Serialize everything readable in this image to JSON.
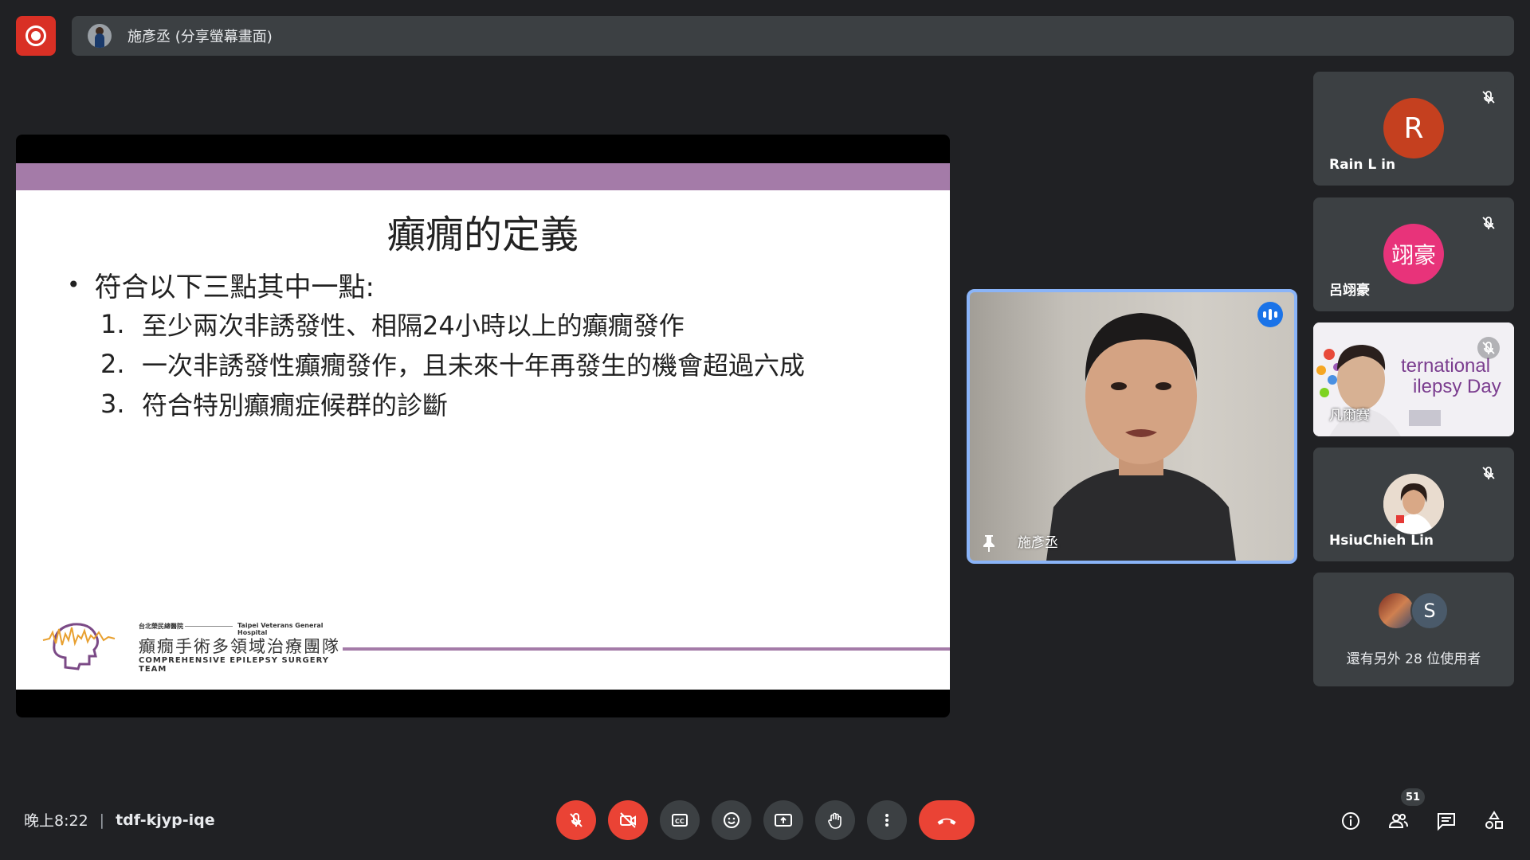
{
  "top_bar": {
    "presenter_label": "施彥丞 (分享螢幕畫面)"
  },
  "slide": {
    "title": "癲癇的定義",
    "bullet": "符合以下三點其中一點:",
    "items": [
      {
        "num": "1.",
        "text": "至少兩次非誘發性、相隔24小時以上的癲癇發作"
      },
      {
        "num": "2.",
        "text": "一次非誘發性癲癇發作，且未來十年再發生的機會超過六成"
      },
      {
        "num": "3.",
        "text": "符合特別癲癇症候群的診斷"
      }
    ],
    "logo": {
      "small_cn": "台北榮民總醫院",
      "small_en": "Taipei Veterans General Hospital",
      "main": "癲癇手術多領域治療團隊",
      "en": "COMPREHENSIVE EPILEPSY SURGERY TEAM"
    }
  },
  "speaker": {
    "name": "施彥丞"
  },
  "participants": [
    {
      "name": "Rain L in",
      "initial": "R",
      "color": "#c5401f"
    },
    {
      "name": "呂翊豪",
      "initial": "翊豪",
      "color": "#e8337a"
    },
    {
      "name": "凡爾賽",
      "banner_line1": "ternational",
      "banner_line2": "ilepsy Day"
    },
    {
      "name": "HsiuChieh Lin"
    }
  ],
  "more_participants": {
    "avatar_initial": "S",
    "text": "還有另外 28 位使用者"
  },
  "bottom_bar": {
    "time": "晚上8:22",
    "meeting_code": "tdf-kjyp-iqe",
    "people_count": "51"
  },
  "colors": {
    "accent_purple": "#a47ba8",
    "meet_red": "#ea4335",
    "active_blue": "#8ab4f8"
  }
}
